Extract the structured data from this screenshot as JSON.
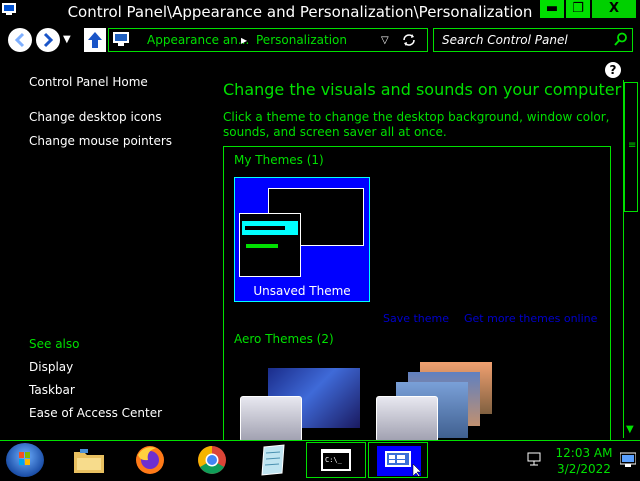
{
  "window": {
    "title": "Control Panel\\Appearance and Personalization\\Personalization",
    "min_label": "▬",
    "max_label": "❐",
    "close_label": "X"
  },
  "nav": {
    "breadcrumb": [
      "Appearance an...",
      "Personalization"
    ],
    "search_placeholder": "Search Control Panel"
  },
  "sidebar": {
    "home": "Control Panel Home",
    "links": [
      "Change desktop icons",
      "Change mouse pointers"
    ],
    "see_also_heading": "See also",
    "see_also": [
      "Display",
      "Taskbar",
      "Ease of Access Center"
    ]
  },
  "main": {
    "title": "Change the visuals and sounds on your computer",
    "description": "Click a theme to change the desktop background, window color, sounds, and screen saver all at once.",
    "my_themes_heading": "My Themes (1)",
    "unsaved_theme_label": "Unsaved Theme",
    "save_theme_link": "Save theme",
    "get_more_link": "Get more themes online",
    "aero_heading": "Aero Themes (2)",
    "help_label": "?"
  },
  "taskbar": {
    "time": "12:03 AM",
    "date": "3/2/2022",
    "items": [
      "start-button",
      "file-explorer",
      "firefox",
      "chrome",
      "notepad",
      "command-prompt",
      "control-panel"
    ]
  },
  "colors": {
    "accent": "#00e000",
    "selection": "#0000ff",
    "highlight": "#00ffff",
    "background": "#000000",
    "text": "#ffffff"
  }
}
